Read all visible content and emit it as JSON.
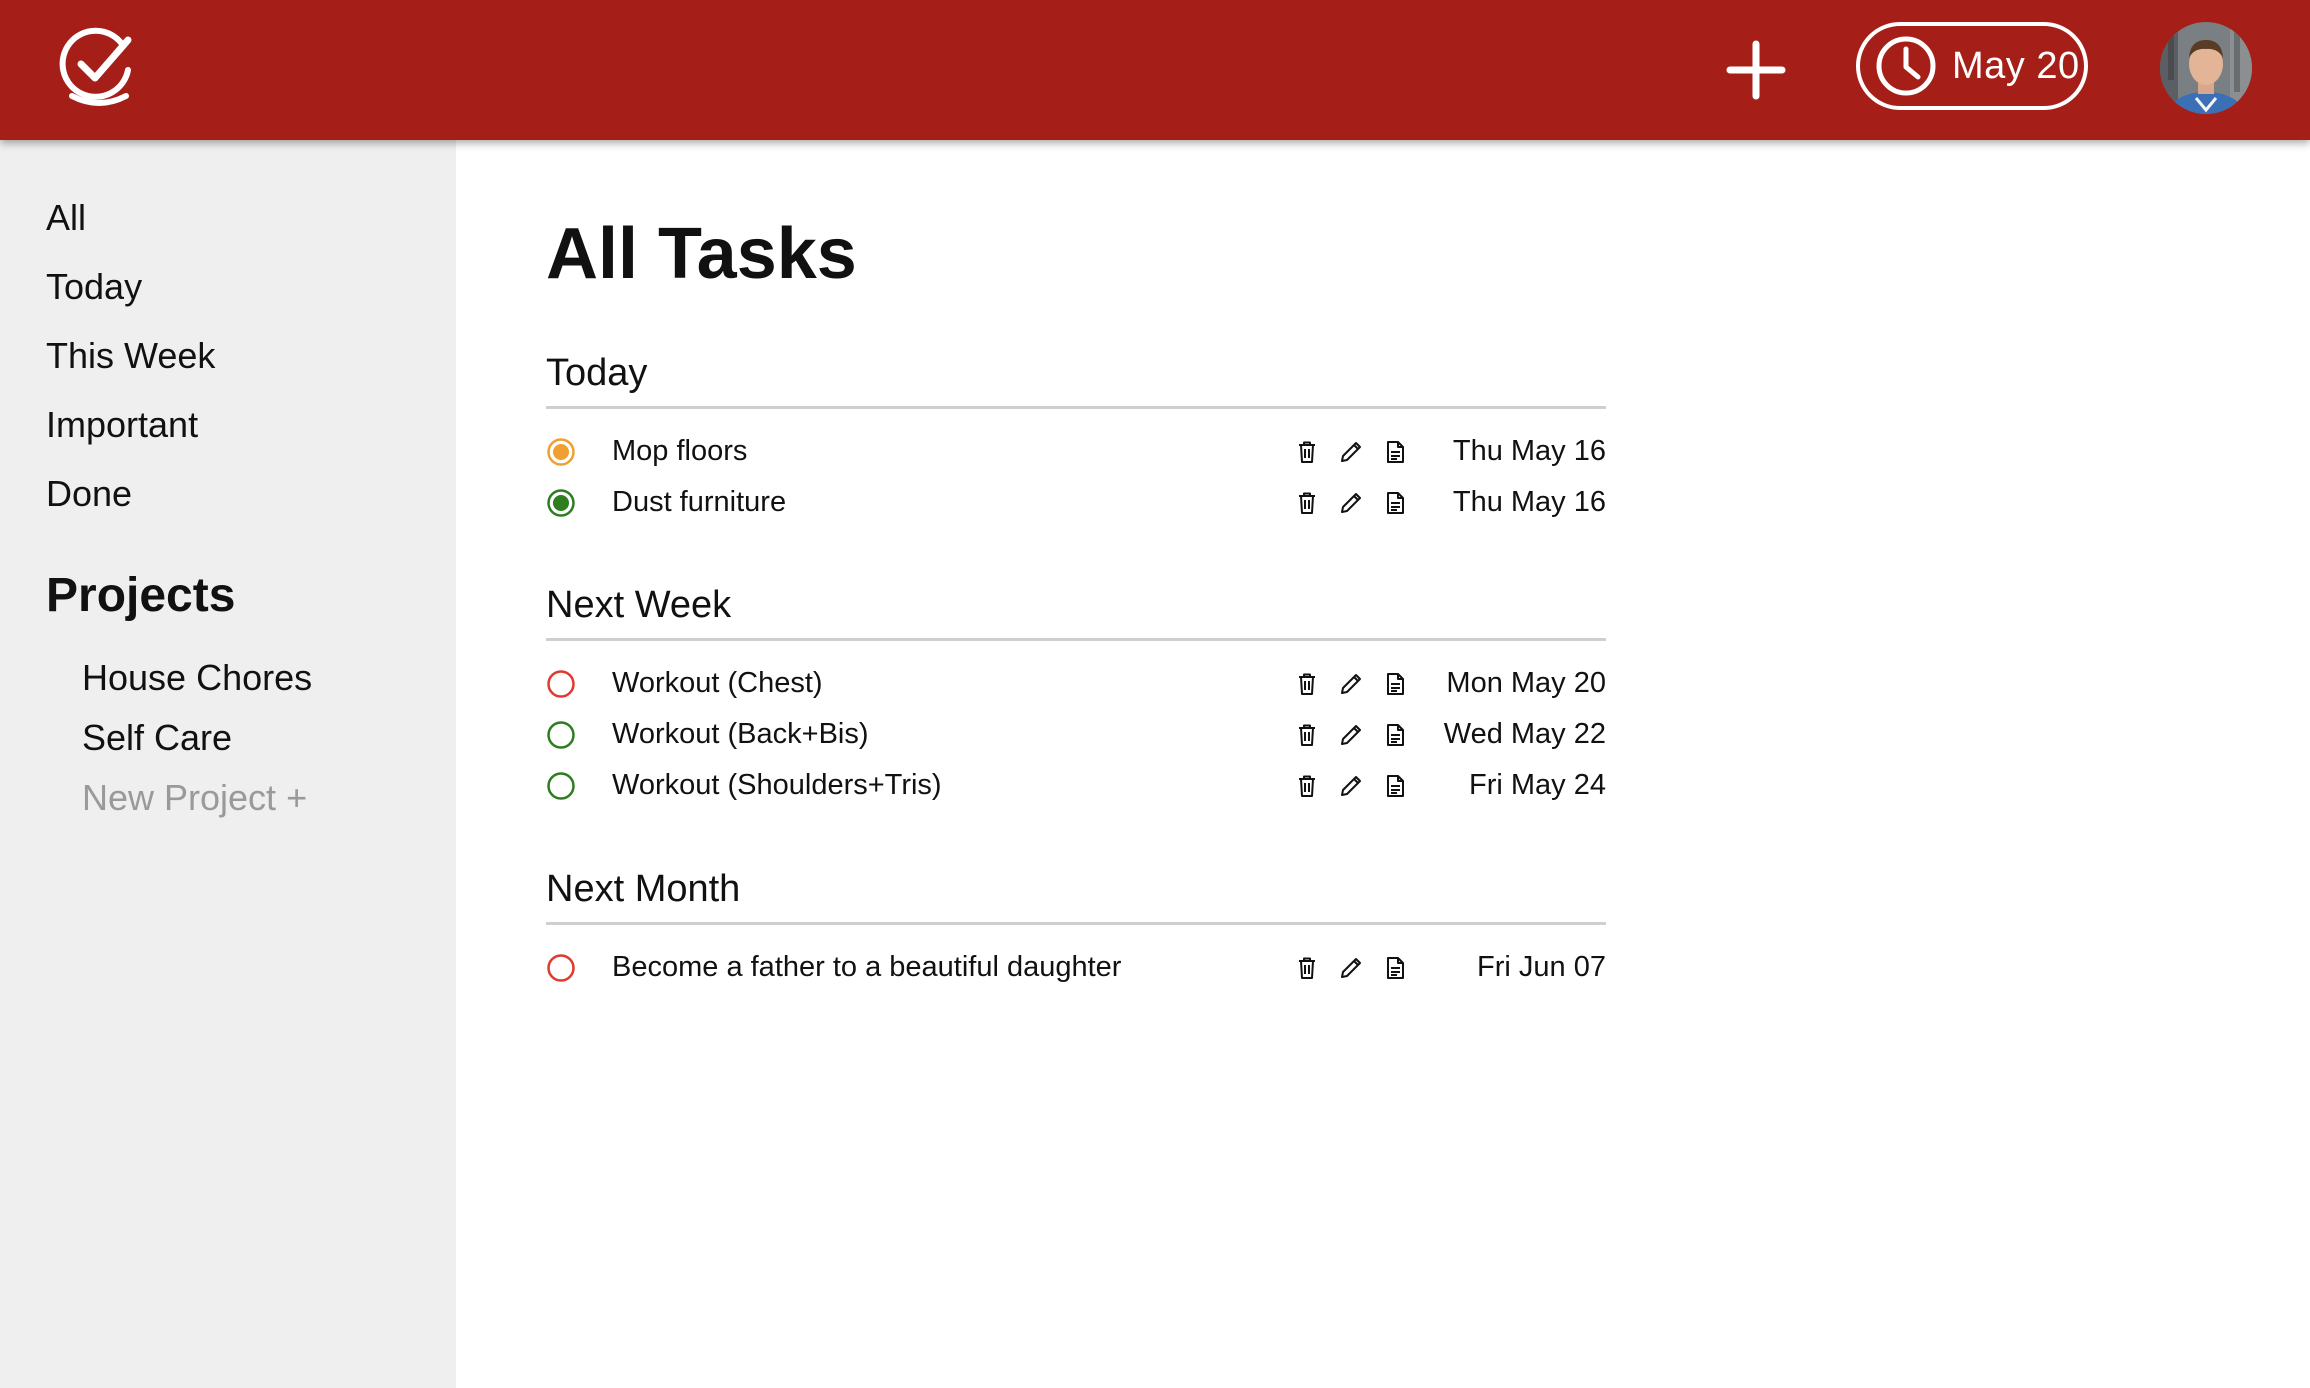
{
  "header": {
    "add_label": "+",
    "date_label": "May 20"
  },
  "sidebar": {
    "items": [
      {
        "label": "All"
      },
      {
        "label": "Today"
      },
      {
        "label": "This Week"
      },
      {
        "label": "Important"
      },
      {
        "label": "Done"
      }
    ],
    "projects_heading": "Projects",
    "projects": [
      {
        "label": "House Chores"
      },
      {
        "label": "Self Care"
      }
    ],
    "new_project_label": "New Project +"
  },
  "main": {
    "title": "All Tasks",
    "sections": [
      {
        "title": "Today",
        "tasks": [
          {
            "title": "Mop floors",
            "date": "Thu May 16",
            "status_color": "#f0a030",
            "filled": true
          },
          {
            "title": "Dust furniture",
            "date": "Thu May 16",
            "status_color": "#2e7d1f",
            "filled": true
          }
        ]
      },
      {
        "title": "Next Week",
        "tasks": [
          {
            "title": "Workout (Chest)",
            "date": "Mon May 20",
            "status_color": "#e03a2f",
            "filled": false
          },
          {
            "title": "Workout (Back+Bis)",
            "date": "Wed May 22",
            "status_color": "#2e7d1f",
            "filled": false
          },
          {
            "title": "Workout (Shoulders+Tris)",
            "date": "Fri May 24",
            "status_color": "#2e7d1f",
            "filled": false
          }
        ]
      },
      {
        "title": "Next Month",
        "tasks": [
          {
            "title": "Become a father to a beautiful daughter",
            "date": "Fri Jun 07",
            "status_color": "#e03a2f",
            "filled": false
          }
        ]
      }
    ]
  },
  "colors": {
    "header_bg": "#a51f18",
    "sidebar_bg": "#efefef",
    "muted_text": "#9a9a9a"
  },
  "icons": {
    "logo": "check-circle-logo-icon",
    "add": "plus-icon",
    "date": "clock-icon",
    "task_actions": [
      "trash-icon",
      "pencil-icon",
      "document-icon"
    ]
  }
}
